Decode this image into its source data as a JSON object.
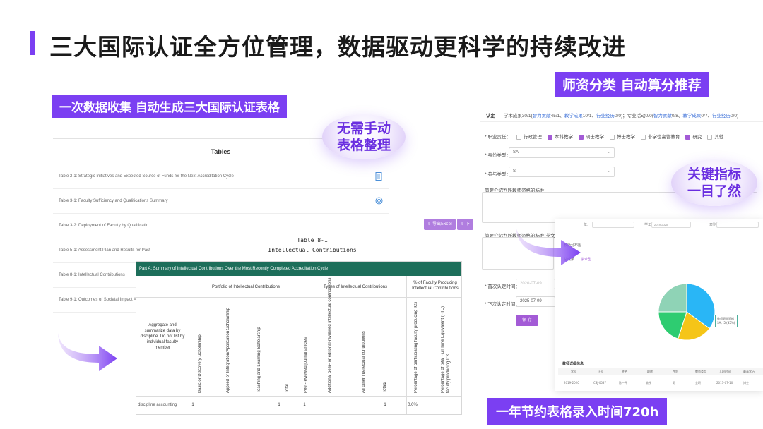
{
  "title": "三大国际认证全方位管理，数据驱动更科学的持续改进",
  "pill_left": "一次数据收集   自动生成三大国际认证表格",
  "pill_right": "师资分类  自动算分推荐",
  "pill_bottom": "一年节约表格录入时间720h",
  "bubble_left": [
    "无需手动",
    "表格整理"
  ],
  "bubble_right": [
    "关键指标",
    "一目了然"
  ],
  "tables_panel": {
    "header": "Tables",
    "rows": [
      {
        "label": "Table 2-1:  Strategic Initiatives and Expected Source of Funds for the Next Accreditation Cycle",
        "icon": "document-icon"
      },
      {
        "label": "Table 3-1: Faculty Sufficiency and Qualifications Summary",
        "icon": "settings-icon"
      },
      {
        "label": "Table 3-2: Deployment of Faculty by Qualificatio",
        "icon": ""
      },
      {
        "label": "Table 5-1: Assessment Plan and Results for Past",
        "icon": ""
      },
      {
        "label": "Table 8-1: Intellectual Contributions",
        "icon": ""
      },
      {
        "label": "Table 9-1: Outcomes of Societal Impact Activiti",
        "icon": ""
      }
    ],
    "export_label": "导出Excel",
    "download_label": "下"
  },
  "table81": {
    "title": "Table 8-1",
    "subtitle": "Intellectual Contributions",
    "banner": "Part A: Summary of Intellectual Contributions Over the Most Recently Completed Accreditation Cycle",
    "group1": "Portfolio of Intellectual Contributions",
    "group2": "Types of Intellectual Contributions",
    "group3": "% of Faculty Producing Intellectual Contributions",
    "row_header": "Aggregate and summarize data by discipline. Do not list by individual faculty member",
    "columns": [
      "Basic or Discovery Scholarship",
      "Applied or Integration/Application Scholarship",
      "Teaching and Learning Scholarship",
      "Total",
      "Peer-reviewed journal articles",
      "Additional peer- or editorial-reviewed intellectual contributions",
      "All other intellectual contributions",
      "Total2",
      "Percentage of participating faculty producing ICs",
      "Percentage of total Full Time Equivalent (FTE) faculty producing ICs"
    ],
    "data_row": {
      "label": "discipline accounting",
      "values": [
        "1",
        "",
        "",
        "1",
        "1",
        "",
        "",
        "1",
        "0.0%",
        ""
      ]
    }
  },
  "form": {
    "tabs": {
      "active": "认定",
      "items": [
        "学术成果30/1(",
        "智力贡献",
        "45/1、",
        "教学成果",
        "10/1、",
        "行业经历",
        "0/0)；专业活动0/0(",
        "智力贡献",
        "0/8、",
        "教学成果",
        "0/7、",
        "行业经历",
        "0/0)"
      ]
    },
    "position_label": "* 职业责任：",
    "positions": [
      {
        "label": "行政管理",
        "checked": false
      },
      {
        "label": "本科教学",
        "checked": true
      },
      {
        "label": "硕士教学",
        "checked": true
      },
      {
        "label": "博士教学",
        "checked": false
      },
      {
        "label": "非学位高管教育",
        "checked": false
      },
      {
        "label": "研究",
        "checked": true
      },
      {
        "label": "其他",
        "checked": false
      }
    ],
    "identity_label": "* 身份类型：",
    "identity_value": "SA",
    "participation_label": "* 参与类型：",
    "participation_value": "S",
    "standard_label": "简要介绍判断教师资格的标准",
    "standard_en_label": "简要介绍判断教师资格的标准(英文)",
    "first_date_label": "* 首次认定时间：",
    "first_date_value": "2020-07-09",
    "next_date_label": "* 下次认定时间：",
    "next_date_value": "2025-07-09",
    "save_label": "保 存"
  },
  "dashboard": {
    "filter_labels": [
      "年:",
      "学年",
      "2019-2020",
      "表别:"
    ],
    "tab_label": "教师分布图",
    "sub_tabs": [
      "总成果",
      "学术型"
    ],
    "tooltip": [
      "教师职业资格",
      "SA：5 (35%)"
    ],
    "table_title": "教师详细信息",
    "table_head": [
      "学号",
      "正号",
      "姓名",
      "职称",
      "性别",
      "教师类型",
      "入职时间",
      "最高学历"
    ],
    "table_row": [
      "2019-2020",
      "CSJ-0037",
      "陈一凡",
      "教授",
      "男",
      "全职",
      "2017-07-10",
      "博士"
    ],
    "chart_colors": [
      "#29b6f6",
      "#f5c518",
      "#2ecc71",
      "#8fd3b6"
    ]
  },
  "chart_data": {
    "type": "pie",
    "values": [
      35,
      20,
      20,
      25
    ],
    "colors": [
      "#29b6f6",
      "#f5c518",
      "#2ecc71",
      "#8fd3b6"
    ]
  }
}
